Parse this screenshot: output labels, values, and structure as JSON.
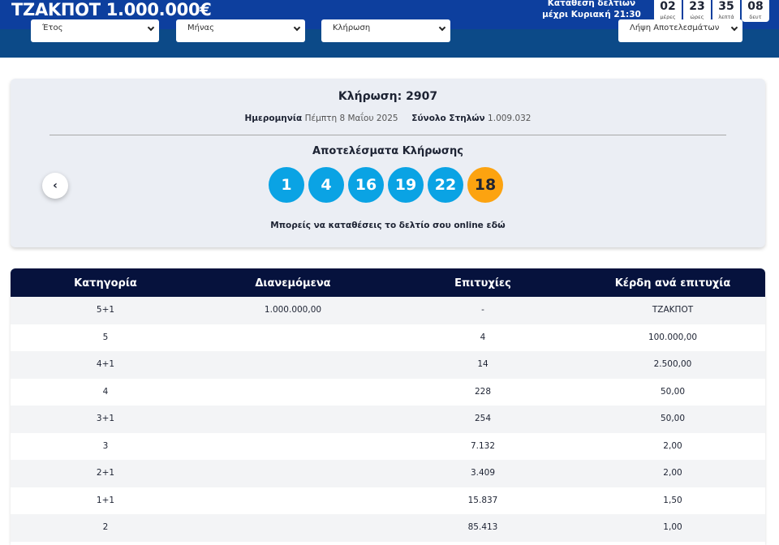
{
  "header": {
    "jackpot": "ΤΖΑΚΠΟΤ 1.000.000€",
    "deadline_line1": "Κατάθεση δελτίων",
    "deadline_line2": "μέχρι Κυριακή 21:30",
    "countdown": [
      {
        "value": "02",
        "unit": "μέρες"
      },
      {
        "value": "23",
        "unit": "ώρες"
      },
      {
        "value": "35",
        "unit": "λεπτά"
      },
      {
        "value": "08",
        "unit": "δευτ"
      }
    ]
  },
  "filters": {
    "year": "Έτος",
    "month": "Μήνας",
    "draw": "Κλήρωση",
    "download": "Λήψη Αποτελεσμάτων"
  },
  "draw": {
    "title": "Κλήρωση: 2907",
    "date_label": "Ημερομηνία",
    "date_value": "Πέμπτη 8 Μαΐου 2025",
    "columns_label": "Σύνολο Στηλών",
    "columns_value": "1.009.032",
    "results_title": "Αποτελέσματα Κλήρωσης",
    "numbers": [
      "1",
      "4",
      "16",
      "19",
      "22"
    ],
    "bonus": "18",
    "prev_icon": "‹",
    "online_text": "Μπορείς να καταθέσεις το δελτίο σου online",
    "online_link": "εδώ"
  },
  "table": {
    "headers": [
      "Κατηγορία",
      "Διανεμόμενα",
      "Επιτυχίες",
      "Κέρδη ανά επιτυχία"
    ],
    "rows": [
      [
        "5+1",
        "1.000.000,00",
        "-",
        "ΤΖΑΚΠΟΤ"
      ],
      [
        "5",
        "",
        "4",
        "100.000,00"
      ],
      [
        "4+1",
        "",
        "14",
        "2.500,00"
      ],
      [
        "4",
        "",
        "228",
        "50,00"
      ],
      [
        "3+1",
        "",
        "254",
        "50,00"
      ],
      [
        "3",
        "",
        "7.132",
        "2,00"
      ],
      [
        "2+1",
        "",
        "3.409",
        "2,00"
      ],
      [
        "1+1",
        "",
        "15.837",
        "1,50"
      ],
      [
        "2",
        "",
        "85.413",
        "1,00"
      ]
    ]
  }
}
